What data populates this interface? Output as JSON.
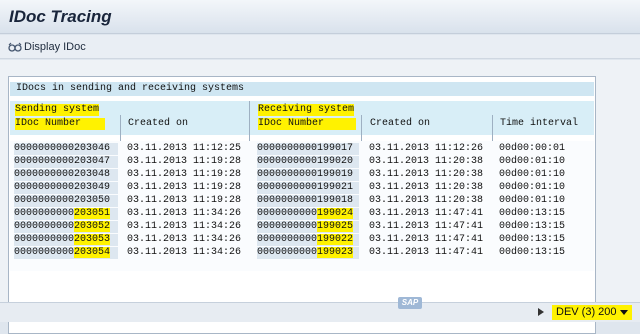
{
  "window": {
    "title": "IDoc Tracing"
  },
  "toolbar": {
    "display_idoc_label": "Display IDoc",
    "display_idoc_icon": "glasses-icon"
  },
  "panel": {
    "header": "IDocs in sending and receiving systems",
    "sending_system_label": "Sending system",
    "receiving_system_label": "Receiving system",
    "columns": [
      "IDoc Number",
      "Created on",
      "IDoc Number",
      "Created on",
      "Time interval"
    ]
  },
  "rows": [
    {
      "send_id_prefix": "0000000000203046",
      "send_id_hl": "",
      "send_created": "03.11.2013 11:12:25",
      "recv_id_prefix": "0000000000199017",
      "recv_id_hl": "",
      "recv_created": "03.11.2013 11:12:26",
      "interval": "00d00:00:01"
    },
    {
      "send_id_prefix": "0000000000203047",
      "send_id_hl": "",
      "send_created": "03.11.2013 11:19:28",
      "recv_id_prefix": "0000000000199020",
      "recv_id_hl": "",
      "recv_created": "03.11.2013 11:20:38",
      "interval": "00d00:01:10"
    },
    {
      "send_id_prefix": "0000000000203048",
      "send_id_hl": "",
      "send_created": "03.11.2013 11:19:28",
      "recv_id_prefix": "0000000000199019",
      "recv_id_hl": "",
      "recv_created": "03.11.2013 11:20:38",
      "interval": "00d00:01:10"
    },
    {
      "send_id_prefix": "0000000000203049",
      "send_id_hl": "",
      "send_created": "03.11.2013 11:19:28",
      "recv_id_prefix": "0000000000199021",
      "recv_id_hl": "",
      "recv_created": "03.11.2013 11:20:38",
      "interval": "00d00:01:10"
    },
    {
      "send_id_prefix": "0000000000203050",
      "send_id_hl": "",
      "send_created": "03.11.2013 11:19:28",
      "recv_id_prefix": "0000000000199018",
      "recv_id_hl": "",
      "recv_created": "03.11.2013 11:20:38",
      "interval": "00d00:01:10"
    },
    {
      "send_id_prefix": "0000000000",
      "send_id_hl": "203051",
      "send_created": "03.11.2013 11:34:26",
      "recv_id_prefix": "0000000000",
      "recv_id_hl": "199024",
      "recv_created": "03.11.2013 11:47:41",
      "interval": "00d00:13:15"
    },
    {
      "send_id_prefix": "0000000000",
      "send_id_hl": "203052",
      "send_created": "03.11.2013 11:34:26",
      "recv_id_prefix": "0000000000",
      "recv_id_hl": "199025",
      "recv_created": "03.11.2013 11:47:41",
      "interval": "00d00:13:15"
    },
    {
      "send_id_prefix": "0000000000",
      "send_id_hl": "203053",
      "send_created": "03.11.2013 11:34:26",
      "recv_id_prefix": "0000000000",
      "recv_id_hl": "199022",
      "recv_created": "03.11.2013 11:47:41",
      "interval": "00d00:13:15"
    },
    {
      "send_id_prefix": "0000000000",
      "send_id_hl": "203054",
      "send_created": "03.11.2013 11:34:26",
      "recv_id_prefix": "0000000000",
      "recv_id_hl": "199023",
      "recv_created": "03.11.2013 11:47:41",
      "interval": "00d00:13:15"
    }
  ],
  "status_bar": {
    "sap_logo_text": "SAP",
    "system_info": "DEV (3) 200",
    "colors": {
      "highlight": "#fff200"
    }
  }
}
